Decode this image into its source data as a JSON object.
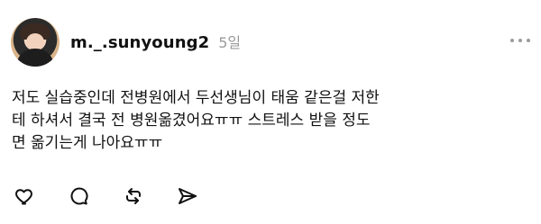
{
  "post": {
    "username": "m._.sunyoung2",
    "time": "5일",
    "text": "저도 실습중인데 전병원에서 두선생님이 태움 같은걸 저한\n테 하셔서 결국 전 병원옮겼어요ㅠㅠ 스트레스 받을 정도\n면 옮기는게 나아요ㅠㅠ"
  },
  "icons": {
    "more": "more-icon",
    "like": "heart-icon",
    "comment": "comment-icon",
    "repost": "repost-icon",
    "share": "share-icon"
  }
}
